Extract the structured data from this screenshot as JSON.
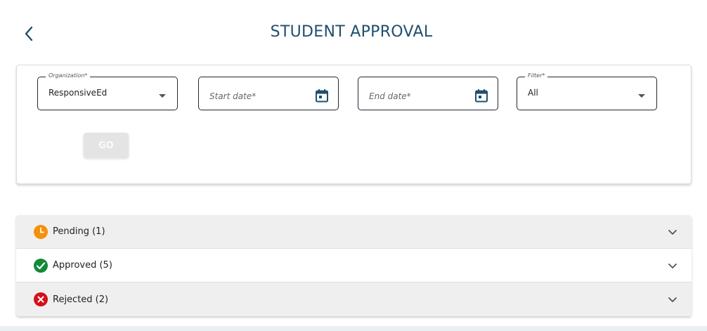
{
  "header": {
    "title": "STUDENT APPROVAL",
    "back_icon": "chevron-left-icon"
  },
  "filters": {
    "organization": {
      "legend": "Organization*",
      "value": "ResponsiveEd"
    },
    "start_date": {
      "placeholder": "Start date*",
      "icon": "calendar-icon"
    },
    "end_date": {
      "placeholder": "End date*",
      "icon": "calendar-icon"
    },
    "filter": {
      "legend": "Filter*",
      "value": "All"
    },
    "go_label": "GO"
  },
  "sections": [
    {
      "label": "Pending (1)",
      "icon": "pending-clock-icon",
      "color": "#f5900b"
    },
    {
      "label": "Approved (5)",
      "icon": "check-circle-icon",
      "color": "#128a36"
    },
    {
      "label": "Rejected (2)",
      "icon": "cancel-circle-icon",
      "color": "#d4111b"
    }
  ],
  "colors": {
    "title": "#1f4f6e",
    "accent_icon": "#1f4f6e"
  }
}
